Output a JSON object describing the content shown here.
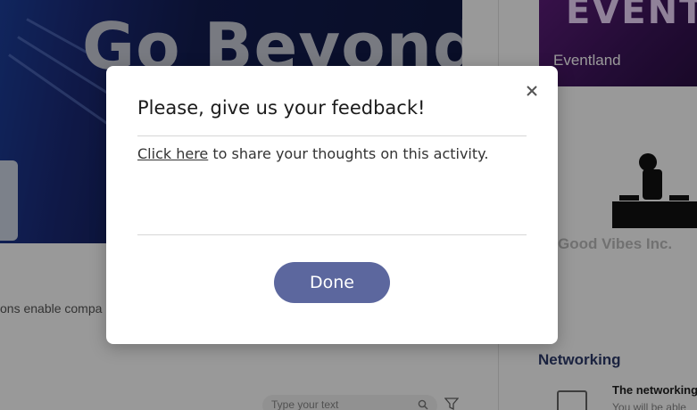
{
  "background": {
    "hero_title": "Go Beyond",
    "event_card": {
      "big_text": "EVENT",
      "name": "Eventland"
    },
    "vibes_card": {
      "name": "Good Vibes Inc."
    },
    "description_snippet": "ons enable compa",
    "networking": {
      "heading": "Networking",
      "item_title": "The networking",
      "item_sub": "You will be able"
    },
    "search": {
      "placeholder": "Type your text"
    }
  },
  "modal": {
    "title": "Please, give us your feedback!",
    "link_text": "Click here",
    "body_text": " to share your thoughts on this activity.",
    "done_label": "Done",
    "close_icon": "close-icon"
  },
  "colors": {
    "accent": "#5c679e",
    "overlay": "rgba(0,0,0,0.40)"
  }
}
